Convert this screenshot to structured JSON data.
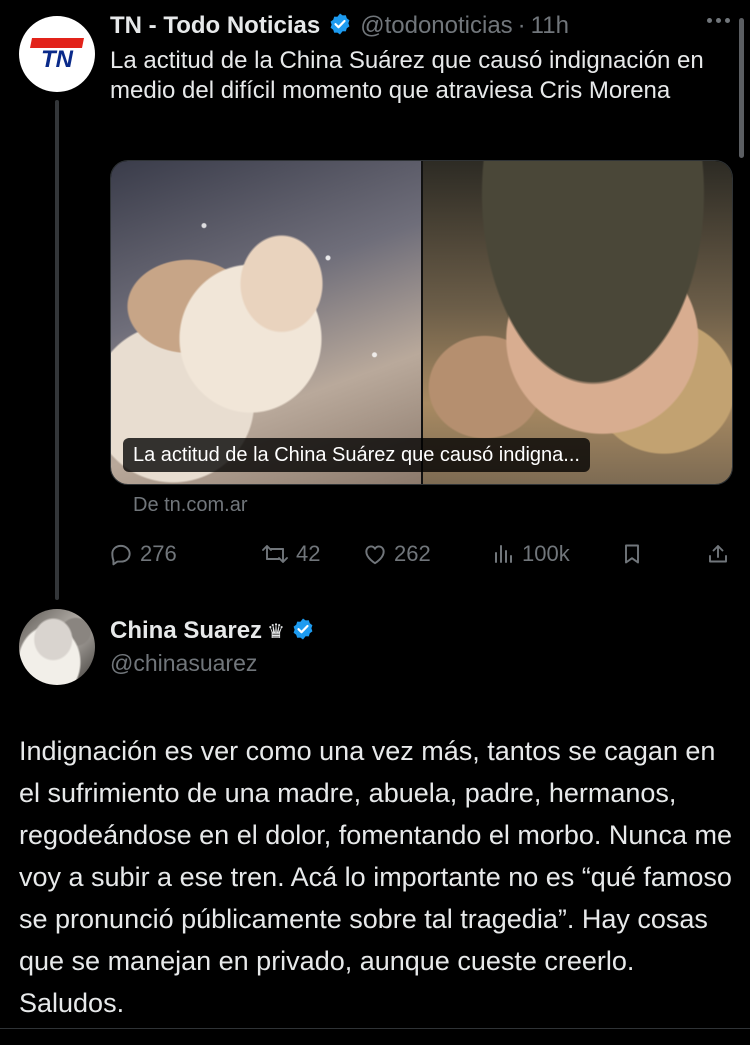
{
  "tweet1": {
    "display_name": "TN - Todo Noticias",
    "handle": "@todonoticias",
    "separator": "·",
    "time": "11h",
    "text": "La actitud de la China Suárez que causó indignación en medio del difícil momento que atraviesa Cris Morena",
    "avatar_logo": "TN",
    "card": {
      "caption": "La actitud de la China Suárez que causó indigna...",
      "source": "De tn.com.ar"
    },
    "stats": {
      "replies": "276",
      "retweets": "42",
      "likes": "262",
      "views": "100k"
    },
    "icons": [
      "verified-badge-icon",
      "more-icon",
      "reply-icon",
      "retweet-icon",
      "like-icon",
      "views-icon",
      "bookmark-icon",
      "share-icon"
    ]
  },
  "tweet2": {
    "display_name": "China Suarez",
    "crown": "♛",
    "handle": "@chinasuarez",
    "text": "Indignación es ver como una vez más, tantos se cagan en el sufrimiento de una madre, abuela, padre, hermanos, regodeándose en el dolor, fomentando el morbo. Nunca me voy a subir a ese tren. Acá lo importante no es “qué famoso se pronunció públicamente sobre tal tragedia”. Hay cosas que se manejan en privado, aunque cueste creerlo. Saludos."
  },
  "colors": {
    "background": "#000000",
    "text_primary": "#e7e9ea",
    "text_secondary": "#71767b",
    "verified_blue": "#1d9bf0",
    "tn_red": "#e2231a",
    "tn_blue": "#0a2a8a"
  }
}
